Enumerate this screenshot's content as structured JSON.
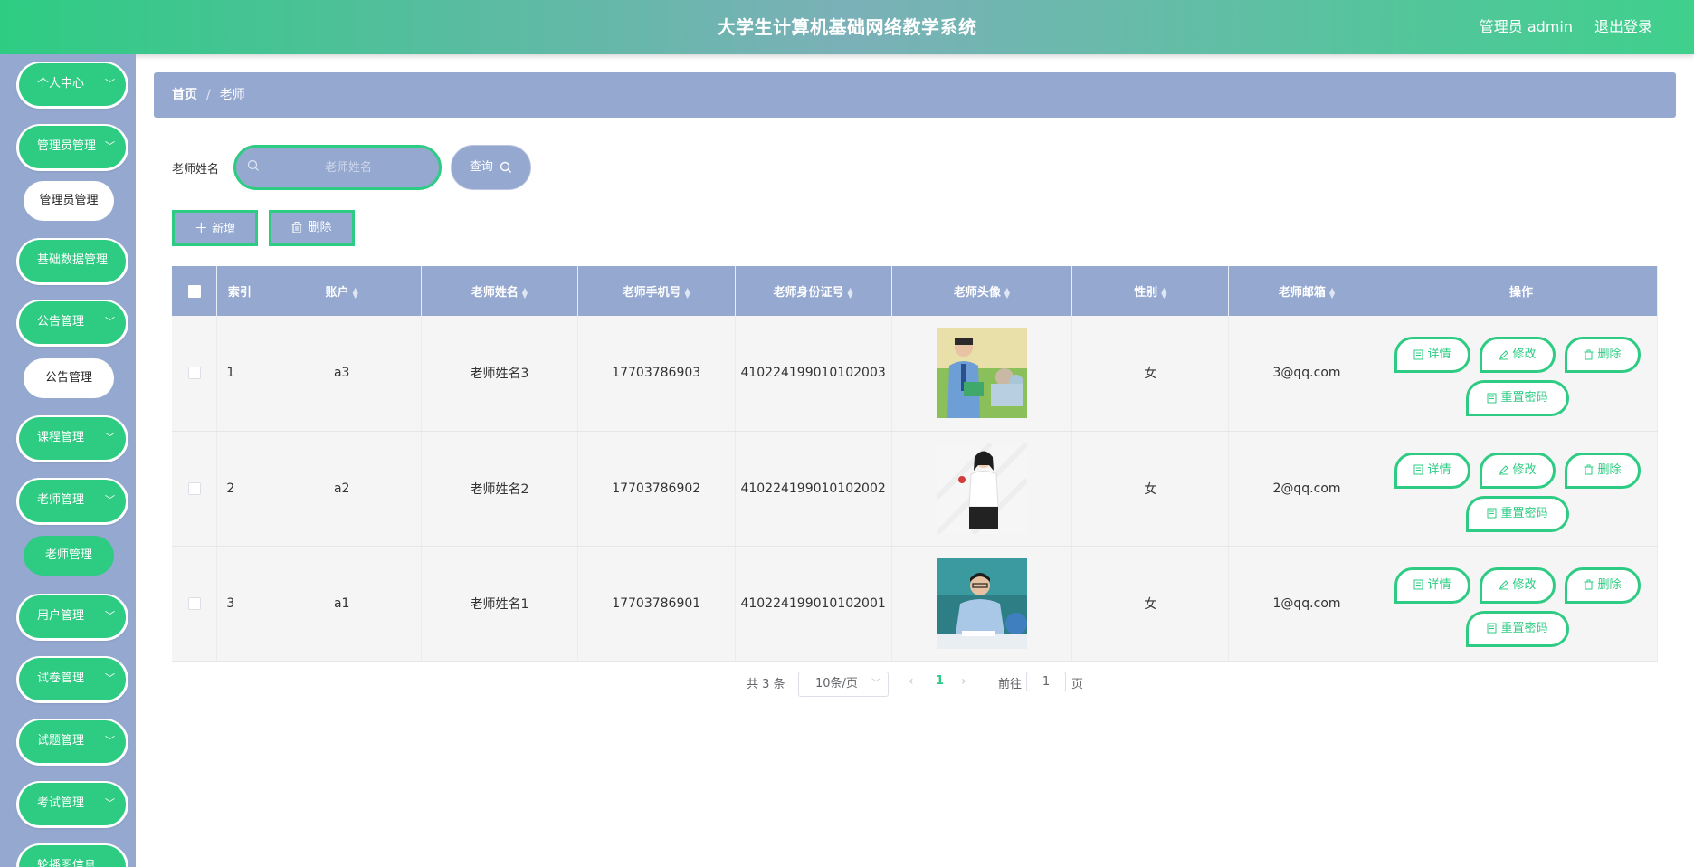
{
  "header": {
    "title": "大学生计算机基础网络教学系统",
    "user": "管理员 admin",
    "logout": "退出登录"
  },
  "sidebar": {
    "items": [
      {
        "label": "个人中心"
      },
      {
        "label": "管理员管理",
        "sub": "管理员管理"
      },
      {
        "label": "基础数据管理"
      },
      {
        "label": "公告管理",
        "sub": "公告管理"
      },
      {
        "label": "课程管理"
      },
      {
        "label": "老师管理",
        "sub": "老师管理"
      },
      {
        "label": "用户管理"
      },
      {
        "label": "试卷管理"
      },
      {
        "label": "试题管理"
      },
      {
        "label": "考试管理"
      },
      {
        "label": "轮播图信息"
      }
    ]
  },
  "breadcrumb": {
    "home": "首页",
    "sep": "/",
    "current": "老师"
  },
  "search": {
    "label": "老师姓名",
    "placeholder": "老师姓名",
    "button": "查询"
  },
  "actions": {
    "add": "新增",
    "delete": "删除"
  },
  "table": {
    "columns": [
      "索引",
      "账户",
      "老师姓名",
      "老师手机号",
      "老师身份证号",
      "老师头像",
      "性别",
      "老师邮箱",
      "操作"
    ],
    "rows": [
      {
        "index": "1",
        "account": "a3",
        "name": "老师姓名3",
        "phone": "17703786903",
        "idcard": "410224199010102003",
        "gender": "女",
        "email": "3@qq.com"
      },
      {
        "index": "2",
        "account": "a2",
        "name": "老师姓名2",
        "phone": "17703786902",
        "idcard": "410224199010102002",
        "gender": "女",
        "email": "2@qq.com"
      },
      {
        "index": "3",
        "account": "a1",
        "name": "老师姓名1",
        "phone": "17703786901",
        "idcard": "410224199010102001",
        "gender": "女",
        "email": "1@qq.com"
      }
    ],
    "ops": {
      "detail": "详情",
      "edit": "修改",
      "delete": "删除",
      "reset": "重置密码"
    }
  },
  "pagination": {
    "total": "共 3 条",
    "size": "10条/页",
    "current": "1",
    "goto": "前往",
    "goto_value": "1",
    "page": "页"
  },
  "colors": {
    "green": "#2ecc83",
    "periwinkle": "#95a8d0"
  }
}
